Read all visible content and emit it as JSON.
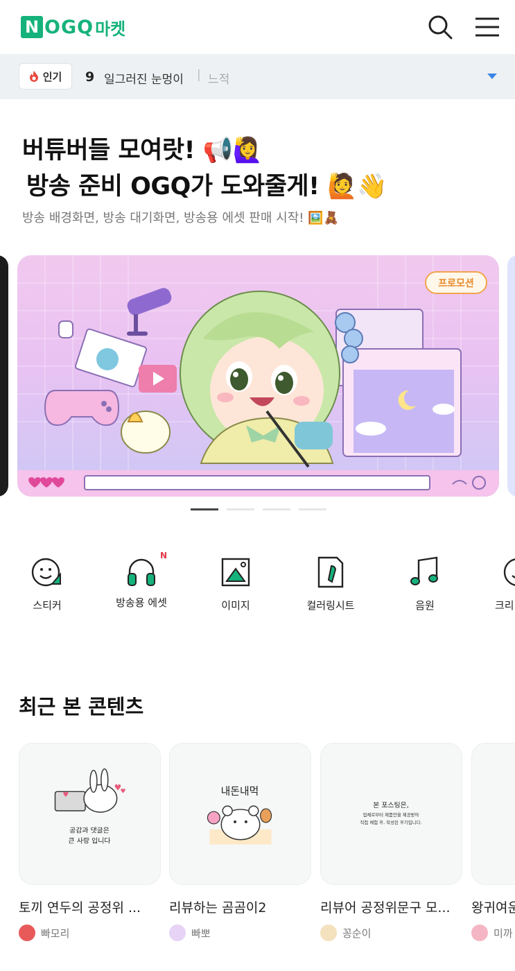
{
  "header": {
    "logo_text": "OGQ",
    "logo_letter": "N",
    "logo_market": "마켓"
  },
  "trending": {
    "badge_label": "인기",
    "rank": "9",
    "term": "일그러진 눈멍이",
    "separator": "|",
    "next_term": "느적"
  },
  "promo": {
    "line1": "버튜버들 모여랏! 📢🙋‍♀️",
    "line2": "방송 준비 OGQ가 도와줄게! 🙋👋",
    "subtitle": "방송 배경화면, 방송 대기화면, 방송용 에셋 판매 시작! 🖼️🧸"
  },
  "banner": {
    "tag": "프로모션",
    "dots_total": 4,
    "dots_active": 1
  },
  "categories": [
    {
      "label": "스티커",
      "icon": "sticker-icon"
    },
    {
      "label": "방송용 에셋",
      "icon": "headset-icon",
      "badge": "N"
    },
    {
      "label": "이미지",
      "icon": "image-icon"
    },
    {
      "label": "컬러링시트",
      "icon": "coloring-icon"
    },
    {
      "label": "음원",
      "icon": "music-icon"
    },
    {
      "label": "크리",
      "icon": "sticker-icon"
    }
  ],
  "recent": {
    "title": "최근 본 콘텐츠",
    "items": [
      {
        "title": "토끼 연두의 공정위 ...",
        "author": "빠모리",
        "thumb_text": "공감과 댓글은\n큰 사랑 입니다",
        "avatar_color": "#e85a5a"
      },
      {
        "title": "리뷰하는 곰곰이2",
        "author": "빠뽀",
        "thumb_text": "내돈내먹",
        "avatar_color": "#c9a2e8"
      },
      {
        "title": "리뷰어 공정위문구 모...",
        "author": "꽁순이",
        "thumb_text": "본 포스팅은,\n업체로부터 제품만을 제공받아\n직접 체험 후, 작성된 후기입니다.",
        "avatar_color": "#f3d9a6"
      },
      {
        "title": "왕귀여운",
        "author": "미까",
        "thumb_text": "",
        "avatar_color": "#f5b6c4"
      }
    ]
  }
}
